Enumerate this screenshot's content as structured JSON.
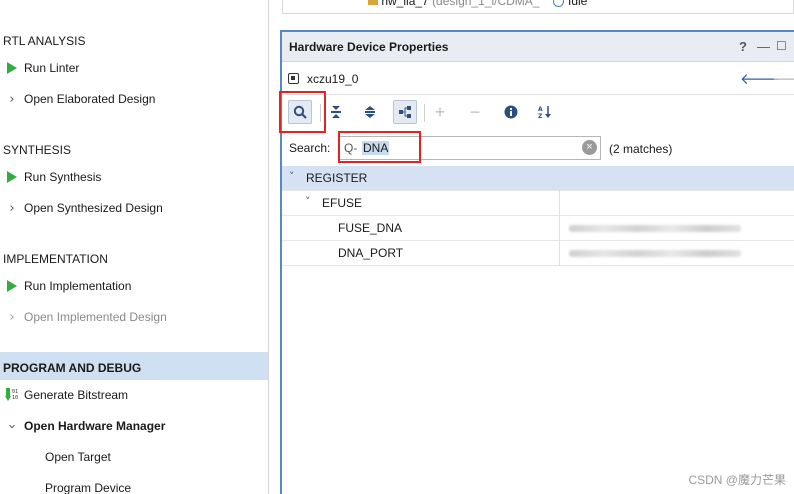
{
  "top_row": {
    "name": "hw_ila_7",
    "detail": "(design_1_i/CDMA_",
    "status": "Idle"
  },
  "flow": {
    "sections": [
      {
        "title": "RTL ANALYSIS",
        "items": [
          {
            "label": "Run Linter",
            "icon": "run-triangle-icon"
          },
          {
            "label": "Open Elaborated Design",
            "icon": "chevron-right-icon"
          }
        ]
      },
      {
        "title": "SYNTHESIS",
        "items": [
          {
            "label": "Run Synthesis",
            "icon": "run-triangle-icon"
          },
          {
            "label": "Open Synthesized Design",
            "icon": "chevron-right-icon"
          }
        ]
      },
      {
        "title": "IMPLEMENTATION",
        "items": [
          {
            "label": "Run Implementation",
            "icon": "run-triangle-icon"
          },
          {
            "label": "Open Implemented Design",
            "icon": "chevron-right-icon",
            "disabled": true
          }
        ]
      },
      {
        "title": "PROGRAM AND DEBUG",
        "selected": true,
        "items": [
          {
            "label": "Generate Bitstream",
            "icon": "bitstream-icon"
          },
          {
            "label": "Open Hardware Manager",
            "icon": "chevron-down-icon"
          },
          {
            "label": "Open Target"
          },
          {
            "label": "Program Device"
          }
        ]
      }
    ]
  },
  "panel": {
    "title": "Hardware Device Properties",
    "help": "?",
    "object_name": "xczu19_0",
    "search": {
      "label": "Search:",
      "value": "DNA",
      "matches": "(2 matches)"
    },
    "tree": [
      {
        "label": "REGISTER",
        "level": 0,
        "expanded": true
      },
      {
        "label": "EFUSE",
        "level": 1,
        "expanded": true
      },
      {
        "label": "FUSE_DNA",
        "level": 2
      },
      {
        "label": "DNA_PORT",
        "level": 2
      }
    ]
  },
  "watermark": "CSDN @魔力芒果",
  "colors": {
    "accent": "#5b87c9",
    "highlight": "#e02424",
    "run": "#2fae3e",
    "selection": "#d0e0f3"
  }
}
